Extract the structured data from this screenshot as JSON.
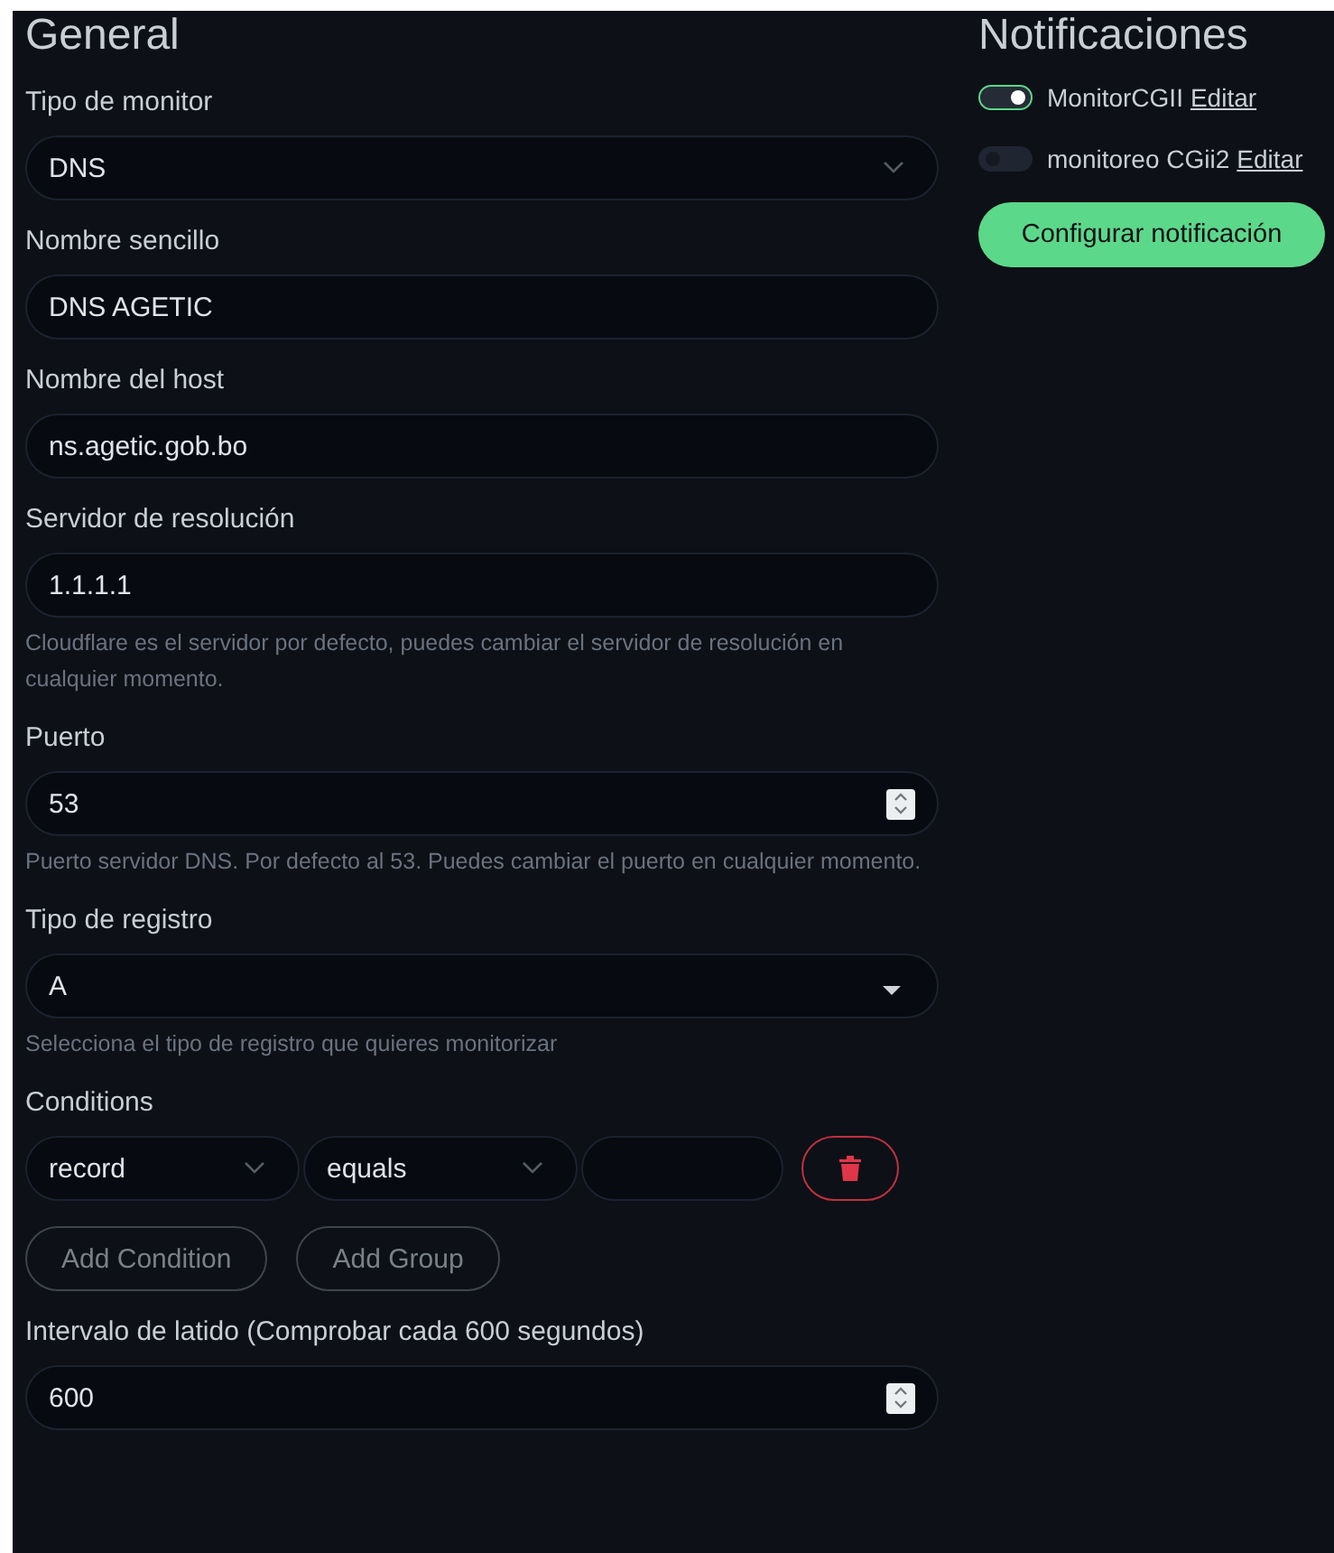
{
  "general": {
    "title": "General",
    "fields": [
      {
        "kind": "dropdown",
        "label": "Tipo de monitor",
        "value": "DNS"
      },
      {
        "kind": "text",
        "label": "Nombre sencillo",
        "value": "DNS AGETIC"
      },
      {
        "kind": "text",
        "label": "Nombre del host",
        "value": "ns.agetic.gob.bo"
      },
      {
        "kind": "text",
        "label": "Servidor de resolución",
        "value": "1.1.1.1",
        "hint": "Cloudflare es el servidor por defecto, puedes cambiar el servidor de resolución en cualquier momento."
      },
      {
        "kind": "number",
        "label": "Puerto",
        "value": "53",
        "hint": "Puerto servidor DNS. Por defecto al 53. Puedes cambiar el puerto en cualquier momento."
      },
      {
        "kind": "select",
        "label": "Tipo de registro",
        "value": "A",
        "hint": "Selecciona el tipo de registro que quieres monitorizar"
      }
    ],
    "conditions": {
      "label": "Conditions",
      "field": "record",
      "operator": "equals",
      "buttons": [
        "Add Condition",
        "Add Group"
      ]
    },
    "interval": {
      "label": "Intervalo de latido (Comprobar cada 600 segundos)",
      "value": "600"
    }
  },
  "notifications": {
    "title": "Notificaciones",
    "items": [
      {
        "name": "MonitorCGII",
        "link": "Editar",
        "on": true
      },
      {
        "name": "monitoreo CGii2",
        "link": "Editar",
        "on": false
      }
    ],
    "button": "Configurar notificación"
  }
}
